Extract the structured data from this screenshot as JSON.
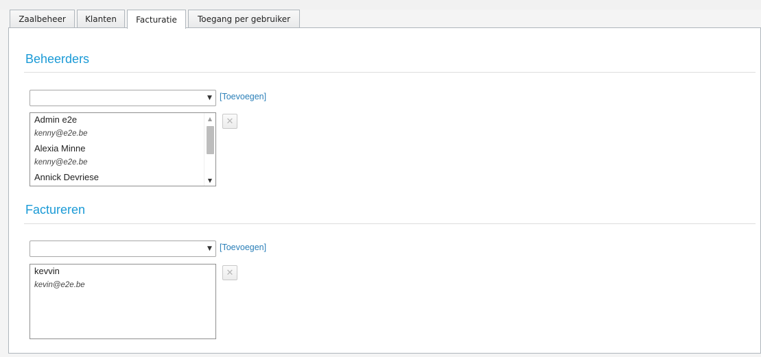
{
  "tabs": [
    {
      "label": "Zaalbeheer"
    },
    {
      "label": "Klanten"
    },
    {
      "label": "Facturatie"
    },
    {
      "label": "Toegang per gebruiker"
    }
  ],
  "active_tab": "Facturatie",
  "beheerders": {
    "title": "Beheerders",
    "select_value": "",
    "add_link": "[Toevoegen]",
    "items": [
      {
        "name": "Admin e2e",
        "email": "kenny@e2e.be"
      },
      {
        "name": "Alexia Minne",
        "email": "kenny@e2e.be"
      },
      {
        "name": "Annick Devriese",
        "email": ""
      }
    ]
  },
  "factureren": {
    "title": "Factureren",
    "select_value": "",
    "add_link": "[Toevoegen]",
    "items": [
      {
        "name": "kevvin",
        "email": "kevin@e2e.be"
      }
    ]
  },
  "icons": {
    "dropdown": "chevron-down-icon",
    "remove": "close-icon",
    "scroll_up": "scroll-up-icon",
    "scroll_down": "scroll-down-icon"
  },
  "colors": {
    "accent": "#1a9ad6",
    "link": "#2a7fb8"
  }
}
